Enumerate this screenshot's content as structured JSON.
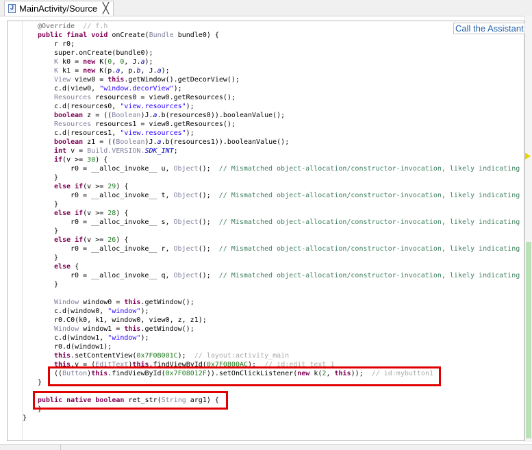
{
  "tab": {
    "title": "MainActivity/Source",
    "close": "╳",
    "icon": "java-file-icon"
  },
  "assistant_button": "Call the Assistant",
  "code_lines": [
    [
      [
        "@Override  ",
        "ann"
      ],
      [
        "// f.h",
        "cmg"
      ]
    ],
    [
      [
        "public final void ",
        "kw"
      ],
      [
        "onCreate(",
        ""
      ],
      [
        "Bundle",
        "ty"
      ],
      [
        " bundle0) {",
        ""
      ]
    ],
    [
      [
        "r r0;",
        ""
      ]
    ],
    [
      [
        "super",
        ""
      ],
      [
        ".onCreate(bundle0);",
        ""
      ]
    ],
    [
      [
        "K",
        "ty"
      ],
      [
        " k0 = ",
        ""
      ],
      [
        "new ",
        "kw"
      ],
      [
        "K(",
        ""
      ],
      [
        "0",
        "num"
      ],
      [
        ", ",
        ""
      ],
      [
        "0",
        "num"
      ],
      [
        ", J.",
        ""
      ],
      [
        "a",
        "fld"
      ],
      [
        ");",
        ""
      ]
    ],
    [
      [
        "K",
        "ty"
      ],
      [
        " k1 = ",
        ""
      ],
      [
        "new ",
        "kw"
      ],
      [
        "K(p.",
        ""
      ],
      [
        "a",
        "fld"
      ],
      [
        ", p.",
        ""
      ],
      [
        "b",
        "fld"
      ],
      [
        ", J.",
        ""
      ],
      [
        "a",
        "fld"
      ],
      [
        ");",
        ""
      ]
    ],
    [
      [
        "View",
        "ty"
      ],
      [
        " view0 = ",
        ""
      ],
      [
        "this",
        "kw"
      ],
      [
        ".getWindow().getDecorView();",
        ""
      ]
    ],
    [
      [
        "c.d(view0, ",
        ""
      ],
      [
        "\"window.decorView\"",
        "str"
      ],
      [
        ");",
        ""
      ]
    ],
    [
      [
        "Resources",
        "ty"
      ],
      [
        " resources0 = view0.getResources();",
        ""
      ]
    ],
    [
      [
        "c.d(resources0, ",
        ""
      ],
      [
        "\"view.resources\"",
        "str"
      ],
      [
        ");",
        ""
      ]
    ],
    [
      [
        "boolean ",
        "kw"
      ],
      [
        "z = ((",
        ""
      ],
      [
        "Boolean",
        "ty"
      ],
      [
        ")J.",
        ""
      ],
      [
        "a",
        "fld"
      ],
      [
        ".b(resources0)).booleanValue();",
        ""
      ]
    ],
    [
      [
        "Resources",
        "ty"
      ],
      [
        " resources1 = view0.getResources();",
        ""
      ]
    ],
    [
      [
        "c.d(resources1, ",
        ""
      ],
      [
        "\"view.resources\"",
        "str"
      ],
      [
        ");",
        ""
      ]
    ],
    [
      [
        "boolean ",
        "kw"
      ],
      [
        "z1 = ((",
        ""
      ],
      [
        "Boolean",
        "ty"
      ],
      [
        ")J.",
        ""
      ],
      [
        "a",
        "fld"
      ],
      [
        ".b(resources1)).booleanValue();",
        ""
      ]
    ],
    [
      [
        "int ",
        "kw"
      ],
      [
        "v = ",
        ""
      ],
      [
        "Build.VERSION.",
        "ty"
      ],
      [
        "SDK_INT",
        "fld"
      ],
      [
        ";",
        ""
      ]
    ],
    [
      [
        "if",
        "kw"
      ],
      [
        "(v >= ",
        ""
      ],
      [
        "30",
        "num"
      ],
      [
        ") {",
        ""
      ]
    ],
    [
      [
        "r0 = __alloc_invoke__ u, ",
        ""
      ],
      [
        "Object",
        "ty"
      ],
      [
        "();  ",
        ""
      ],
      [
        "// Mismatched object-allocation/constructor-invocation, likely indicating",
        "cm"
      ]
    ],
    [
      [
        "}",
        ""
      ]
    ],
    [
      [
        "else if",
        "kw"
      ],
      [
        "(v >= ",
        ""
      ],
      [
        "29",
        "num"
      ],
      [
        ") {",
        ""
      ]
    ],
    [
      [
        "r0 = __alloc_invoke__ t, ",
        ""
      ],
      [
        "Object",
        "ty"
      ],
      [
        "();  ",
        ""
      ],
      [
        "// Mismatched object-allocation/constructor-invocation, likely indicating",
        "cm"
      ]
    ],
    [
      [
        "}",
        ""
      ]
    ],
    [
      [
        "else if",
        "kw"
      ],
      [
        "(v >= ",
        ""
      ],
      [
        "28",
        "num"
      ],
      [
        ") {",
        ""
      ]
    ],
    [
      [
        "r0 = __alloc_invoke__ s, ",
        ""
      ],
      [
        "Object",
        "ty"
      ],
      [
        "();  ",
        ""
      ],
      [
        "// Mismatched object-allocation/constructor-invocation, likely indicating",
        "cm"
      ]
    ],
    [
      [
        "}",
        ""
      ]
    ],
    [
      [
        "else if",
        "kw"
      ],
      [
        "(v >= ",
        ""
      ],
      [
        "26",
        "num"
      ],
      [
        ") {",
        ""
      ]
    ],
    [
      [
        "r0 = __alloc_invoke__ r, ",
        ""
      ],
      [
        "Object",
        "ty"
      ],
      [
        "();  ",
        ""
      ],
      [
        "// Mismatched object-allocation/constructor-invocation, likely indicating",
        "cm"
      ]
    ],
    [
      [
        "}",
        ""
      ]
    ],
    [
      [
        "else ",
        "kw"
      ],
      [
        "{",
        ""
      ]
    ],
    [
      [
        "r0 = __alloc_invoke__ q, ",
        ""
      ],
      [
        "Object",
        "ty"
      ],
      [
        "();  ",
        ""
      ],
      [
        "// Mismatched object-allocation/constructor-invocation, likely indicating",
        "cm"
      ]
    ],
    [
      [
        "}",
        ""
      ]
    ],
    [
      [
        "",
        ""
      ]
    ],
    [
      [
        "Window",
        "ty"
      ],
      [
        " window0 = ",
        ""
      ],
      [
        "this",
        "kw"
      ],
      [
        ".getWindow();",
        ""
      ]
    ],
    [
      [
        "c.d(window0, ",
        ""
      ],
      [
        "\"window\"",
        "str"
      ],
      [
        ");",
        ""
      ]
    ],
    [
      [
        "r0.C0(k0, k1, window0, view0, z, z1);",
        ""
      ]
    ],
    [
      [
        "Window",
        "ty"
      ],
      [
        " window1 = ",
        ""
      ],
      [
        "this",
        "kw"
      ],
      [
        ".getWindow();",
        ""
      ]
    ],
    [
      [
        "c.d(window1, ",
        ""
      ],
      [
        "\"window\"",
        "str"
      ],
      [
        ");",
        ""
      ]
    ],
    [
      [
        "r0.d(window1);",
        ""
      ]
    ],
    [
      [
        "this",
        "kw"
      ],
      [
        ".setContentView(",
        ""
      ],
      [
        "0x7F0B001C",
        "num"
      ],
      [
        ");  ",
        ""
      ],
      [
        "// layout:activity_main",
        "cmg"
      ]
    ],
    [
      [
        "this",
        "kw"
      ],
      [
        ".v = (",
        ""
      ],
      [
        "EditText",
        "ty"
      ],
      [
        ")",
        ""
      ],
      [
        "this",
        "kw"
      ],
      [
        ".findViewById(",
        ""
      ],
      [
        "0x7F0800AC",
        "num"
      ],
      [
        ");  ",
        ""
      ],
      [
        "// id:edit_text_1",
        "cmg"
      ]
    ],
    [
      [
        "((",
        ""
      ],
      [
        "Button",
        "ty"
      ],
      [
        ")",
        ""
      ],
      [
        "this",
        "kw"
      ],
      [
        ".findViewById(",
        ""
      ],
      [
        "0x7F08012F",
        "num"
      ],
      [
        ")).setOnClickListener(",
        ""
      ],
      [
        "new ",
        "kw"
      ],
      [
        "k(",
        ""
      ],
      [
        "2",
        "num"
      ],
      [
        ", ",
        ""
      ],
      [
        "this",
        "kw"
      ],
      [
        "));  ",
        ""
      ],
      [
        "// id:mybutton1",
        "cmg"
      ]
    ],
    [
      [
        "}",
        ""
      ]
    ],
    [
      [
        "",
        ""
      ]
    ],
    [
      [
        "public native boolean ",
        "kw"
      ],
      [
        "ret_str(",
        ""
      ],
      [
        "String",
        "ty"
      ],
      [
        " arg1) {",
        ""
      ]
    ],
    [
      [
        "}",
        ""
      ]
    ],
    [
      [
        "}",
        ""
      ]
    ]
  ]
}
